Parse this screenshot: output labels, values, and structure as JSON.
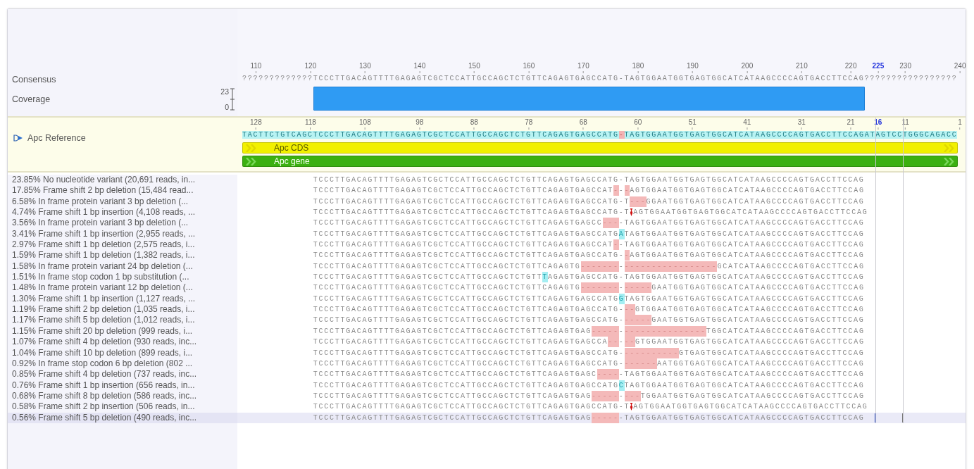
{
  "consensus": {
    "label": "Consensus",
    "ruler": [
      {
        "label": "110",
        "selected": false
      },
      {
        "label": "120",
        "selected": false
      },
      {
        "label": "130",
        "selected": false
      },
      {
        "label": "140",
        "selected": false
      },
      {
        "label": "150",
        "selected": false
      },
      {
        "label": "160",
        "selected": false
      },
      {
        "label": "170",
        "selected": false
      },
      {
        "label": "180",
        "selected": false
      },
      {
        "label": "190",
        "selected": false
      },
      {
        "label": "200",
        "selected": false
      },
      {
        "label": "210",
        "selected": false
      },
      {
        "label": "220",
        "selected": false
      },
      {
        "label": "225",
        "selected": true
      },
      {
        "label": "230",
        "selected": false
      },
      {
        "label": "240",
        "selected": false
      }
    ],
    "sequence": "?????????????TCCCTTGACAGTTTTGAGAGTCGCTCCATTGCCAGCTCTGTTCAGAGTGAGCCATG-TAGTGGAATGGTGAGTGGCATCATAAGCCCCAGTGACCTTCCAG?????????????????"
  },
  "coverage": {
    "label": "Coverage",
    "max": "23",
    "min": "0"
  },
  "reference": {
    "label": "Apc Reference",
    "ruler": [
      {
        "label": "128",
        "selected": false
      },
      {
        "label": "118",
        "selected": false
      },
      {
        "label": "108",
        "selected": false
      },
      {
        "label": "98",
        "selected": false
      },
      {
        "label": "88",
        "selected": false
      },
      {
        "label": "78",
        "selected": false
      },
      {
        "label": "68",
        "selected": false
      },
      {
        "label": "60",
        "selected": false
      },
      {
        "label": "51",
        "selected": false
      },
      {
        "label": "41",
        "selected": false
      },
      {
        "label": "31",
        "selected": false
      },
      {
        "label": "21",
        "selected": false
      },
      {
        "label": "16",
        "selected": true
      },
      {
        "label": "11",
        "selected": false
      },
      {
        "label": "1",
        "selected": false
      }
    ],
    "segments": [
      {
        "kind": "match",
        "text": "TACTTCTGTCAGCTCCCTTGACAGTTTTGAGAGTCGCTCCATTGCCAGCTCTGTTCAGAGTGAGCCATG"
      },
      {
        "kind": "deletion",
        "text": "-"
      },
      {
        "kind": "match",
        "text": "TAGTGGAATGGTGAGTGGCATCATAAGCCCCAGTGACCTTCCAGATAGTCCTGGGCAGACC"
      }
    ],
    "annotations": [
      {
        "label": "Apc CDS",
        "color": "#f2f000"
      },
      {
        "label": "Apc gene",
        "color": "#3cb010"
      }
    ]
  },
  "reads": [
    {
      "label": "23.85% No nucleotide variant (20,691 reads, in...",
      "selected": false,
      "segments": [
        {
          "kind": "match",
          "text": "TCCCTTGACAGTTTTGAGAGTCGCTCCATTGCCAGCTCTGTTCAGAGTGAGCCATG-TAGTGGAATGGTGAGTGGCATCATAAGCCCCAGTGACCTTCCAG"
        }
      ]
    },
    {
      "label": "17.85% Frame shift 2 bp deletion (15,484 read...",
      "selected": false,
      "segments": [
        {
          "kind": "match",
          "text": "TCCCTTGACAGTTTTGAGAGTCGCTCCATTGCCAGCTCTGTTCAGAGTGAGCCAT"
        },
        {
          "kind": "deletion",
          "text": "-"
        },
        {
          "kind": "match",
          "text": "-"
        },
        {
          "kind": "deletion",
          "text": "-"
        },
        {
          "kind": "match",
          "text": "AGTGGAATGGTGAGTGGCATCATAAGCCCCAGTGACCTTCCAG"
        }
      ]
    },
    {
      "label": "6.58% In frame protein variant 3 bp deletion (...",
      "selected": false,
      "segments": [
        {
          "kind": "match",
          "text": "TCCCTTGACAGTTTTGAGAGTCGCTCCATTGCCAGCTCTGTTCAGAGTGAGCCATG-T"
        },
        {
          "kind": "deletion",
          "text": "---"
        },
        {
          "kind": "match",
          "text": "GGAATGGTGAGTGGCATCATAAGCCCCAGTGACCTTCCAG"
        }
      ]
    },
    {
      "label": "4.74% Frame shift 1 bp insertion (4,108 reads, ...",
      "selected": false,
      "segments": [
        {
          "kind": "match",
          "text": "TCCCTTGACAGTTTTGAGAGTCGCTCCATTGCCAGCTCTGTTCAGAGTGAGCCATG-T"
        },
        {
          "kind": "insertion"
        },
        {
          "kind": "match",
          "text": "AGTGGAATGGTGAGTGGCATCATAAGCCCCAGTGACCTTCCAG"
        }
      ]
    },
    {
      "label": "3.56% In frame protein variant 3 bp deletion (...",
      "selected": false,
      "segments": [
        {
          "kind": "match",
          "text": "TCCCTTGACAGTTTTGAGAGTCGCTCCATTGCCAGCTCTGTTCAGAGTGAGCC"
        },
        {
          "kind": "deletion",
          "text": "---"
        },
        {
          "kind": "match",
          "text": "-TAGTGGAATGGTGAGTGGCATCATAAGCCCCAGTGACCTTCCAG"
        }
      ]
    },
    {
      "label": "3.41% Frame shift 1 bp insertion (2,955 reads, ...",
      "selected": false,
      "segments": [
        {
          "kind": "match",
          "text": "TCCCTTGACAGTTTTGAGAGTCGCTCCATTGCCAGCTCTGTTCAGAGTGAGCCATG"
        },
        {
          "kind": "base",
          "text": "A"
        },
        {
          "kind": "match",
          "text": "TAGTGGAATGGTGAGTGGCATCATAAGCCCCAGTGACCTTCCAG"
        }
      ]
    },
    {
      "label": "2.97% Frame shift 1 bp deletion (2,575 reads, i...",
      "selected": false,
      "segments": [
        {
          "kind": "match",
          "text": "TCCCTTGACAGTTTTGAGAGTCGCTCCATTGCCAGCTCTGTTCAGAGTGAGCCAT"
        },
        {
          "kind": "deletion",
          "text": "-"
        },
        {
          "kind": "match",
          "text": "-TAGTGGAATGGTGAGTGGCATCATAAGCCCCAGTGACCTTCCAG"
        }
      ]
    },
    {
      "label": "1.59% Frame shift 1 bp deletion (1,382 reads, i...",
      "selected": false,
      "segments": [
        {
          "kind": "match",
          "text": "TCCCTTGACAGTTTTGAGAGTCGCTCCATTGCCAGCTCTGTTCAGAGTGAGCCATG-"
        },
        {
          "kind": "deletion",
          "text": "-"
        },
        {
          "kind": "match",
          "text": "AGTGGAATGGTGAGTGGCATCATAAGCCCCAGTGACCTTCCAG"
        }
      ]
    },
    {
      "label": "1.58% In frame protein variant 24 bp deletion (...",
      "selected": false,
      "segments": [
        {
          "kind": "match",
          "text": "TCCCTTGACAGTTTTGAGAGTCGCTCCATTGCCAGCTCTGTTCAGAGTG"
        },
        {
          "kind": "deletion",
          "text": "-------"
        },
        {
          "kind": "match",
          "text": "-"
        },
        {
          "kind": "deletion",
          "text": "-----------------"
        },
        {
          "kind": "match",
          "text": "GCATCATAAGCCCCAGTGACCTTCCAG"
        }
      ]
    },
    {
      "label": "1.51% In frame stop codon 1 bp substitution (...",
      "selected": false,
      "segments": [
        {
          "kind": "match",
          "text": "TCCCTTGACAGTTTTGAGAGTCGCTCCATTGCCAGCTCTGTT"
        },
        {
          "kind": "base",
          "text": "T"
        },
        {
          "kind": "match",
          "text": "AGAGTGAGCCATG-TAGTGGAATGGTGAGTGGCATCATAAGCCCCAGTGACCTTCCAG"
        }
      ]
    },
    {
      "label": "1.48% In frame protein variant 12 bp deletion (...",
      "selected": false,
      "segments": [
        {
          "kind": "match",
          "text": "TCCCTTGACAGTTTTGAGAGTCGCTCCATTGCCAGCTCTGTTCAGAGTG"
        },
        {
          "kind": "deletion",
          "text": "-------"
        },
        {
          "kind": "match",
          "text": "-"
        },
        {
          "kind": "deletion",
          "text": "-----"
        },
        {
          "kind": "match",
          "text": "GAATGGTGAGTGGCATCATAAGCCCCAGTGACCTTCCAG"
        }
      ]
    },
    {
      "label": "1.30% Frame shift 1 bp insertion (1,127 reads, ...",
      "selected": false,
      "segments": [
        {
          "kind": "match",
          "text": "TCCCTTGACAGTTTTGAGAGTCGCTCCATTGCCAGCTCTGTTCAGAGTGAGCCATG"
        },
        {
          "kind": "base",
          "text": "G"
        },
        {
          "kind": "match",
          "text": "TAGTGGAATGGTGAGTGGCATCATAAGCCCCAGTGACCTTCCAG"
        }
      ]
    },
    {
      "label": "1.19% Frame shift 2 bp deletion (1,035 reads, i...",
      "selected": false,
      "segments": [
        {
          "kind": "match",
          "text": "TCCCTTGACAGTTTTGAGAGTCGCTCCATTGCCAGCTCTGTTCAGAGTGAGCCATG-"
        },
        {
          "kind": "deletion",
          "text": "--"
        },
        {
          "kind": "match",
          "text": "GTGGAATGGTGAGTGGCATCATAAGCCCCAGTGACCTTCCAG"
        }
      ]
    },
    {
      "label": "1.17% Frame shift 5 bp deletion (1,012 reads, i...",
      "selected": false,
      "segments": [
        {
          "kind": "match",
          "text": "TCCCTTGACAGTTTTGAGAGTCGCTCCATTGCCAGCTCTGTTCAGAGTGAGCCATG-"
        },
        {
          "kind": "deletion",
          "text": "-----"
        },
        {
          "kind": "match",
          "text": "GAATGGTGAGTGGCATCATAAGCCCCAGTGACCTTCCAG"
        }
      ]
    },
    {
      "label": "1.15% Frame shift 20 bp deletion (999 reads, i...",
      "selected": false,
      "segments": [
        {
          "kind": "match",
          "text": "TCCCTTGACAGTTTTGAGAGTCGCTCCATTGCCAGCTCTGTTCAGAGTGAG"
        },
        {
          "kind": "deletion",
          "text": "-----"
        },
        {
          "kind": "match",
          "text": "-"
        },
        {
          "kind": "deletion",
          "text": "---------------"
        },
        {
          "kind": "match",
          "text": "TGGCATCATAAGCCCCAGTGACCTTCCAG"
        }
      ]
    },
    {
      "label": "1.07% Frame shift 4 bp deletion (930 reads, inc...",
      "selected": false,
      "segments": [
        {
          "kind": "match",
          "text": "TCCCTTGACAGTTTTGAGAGTCGCTCCATTGCCAGCTCTGTTCAGAGTGAGCCA"
        },
        {
          "kind": "deletion",
          "text": "--"
        },
        {
          "kind": "match",
          "text": "-"
        },
        {
          "kind": "deletion",
          "text": "--"
        },
        {
          "kind": "match",
          "text": "GTGGAATGGTGAGTGGCATCATAAGCCCCAGTGACCTTCCAG"
        }
      ]
    },
    {
      "label": "1.04% Frame shift 10 bp deletion (899 reads, i...",
      "selected": false,
      "segments": [
        {
          "kind": "match",
          "text": "TCCCTTGACAGTTTTGAGAGTCGCTCCATTGCCAGCTCTGTTCAGAGTGAGCCATG-"
        },
        {
          "kind": "deletion",
          "text": "----------"
        },
        {
          "kind": "match",
          "text": "GTGAGTGGCATCATAAGCCCCAGTGACCTTCCAG"
        }
      ]
    },
    {
      "label": "0.92% In frame stop codon 6 bp deletion (802 ...",
      "selected": false,
      "segments": [
        {
          "kind": "match",
          "text": "TCCCTTGACAGTTTTGAGAGTCGCTCCATTGCCAGCTCTGTTCAGAGTGAGCCATG-"
        },
        {
          "kind": "deletion",
          "text": "------"
        },
        {
          "kind": "match",
          "text": "AATGGTGAGTGGCATCATAAGCCCCAGTGACCTTCCAG"
        }
      ]
    },
    {
      "label": "0.85% Frame shift 4 bp deletion (737 reads, inc...",
      "selected": false,
      "segments": [
        {
          "kind": "match",
          "text": "TCCCTTGACAGTTTTGAGAGTCGCTCCATTGCCAGCTCTGTTCAGAGTGAGC"
        },
        {
          "kind": "deletion",
          "text": "----"
        },
        {
          "kind": "match",
          "text": "-TAGTGGAATGGTGAGTGGCATCATAAGCCCCAGTGACCTTCCAG"
        }
      ]
    },
    {
      "label": "0.76% Frame shift 1 bp insertion (656 reads, in...",
      "selected": false,
      "segments": [
        {
          "kind": "match",
          "text": "TCCCTTGACAGTTTTGAGAGTCGCTCCATTGCCAGCTCTGTTCAGAGTGAGCCATG"
        },
        {
          "kind": "base",
          "text": "C"
        },
        {
          "kind": "match",
          "text": "TAGTGGAATGGTGAGTGGCATCATAAGCCCCAGTGACCTTCCAG"
        }
      ]
    },
    {
      "label": "0.68% Frame shift 8 bp deletion (586 reads, inc...",
      "selected": false,
      "segments": [
        {
          "kind": "match",
          "text": "TCCCTTGACAGTTTTGAGAGTCGCTCCATTGCCAGCTCTGTTCAGAGTGAG"
        },
        {
          "kind": "deletion",
          "text": "-----"
        },
        {
          "kind": "match",
          "text": "-"
        },
        {
          "kind": "deletion",
          "text": "---"
        },
        {
          "kind": "match",
          "text": "TGGAATGGTGAGTGGCATCATAAGCCCCAGTGACCTTCCAG"
        }
      ]
    },
    {
      "label": "0.58% Frame shift 2 bp insertion (506 reads, in...",
      "selected": false,
      "segments": [
        {
          "kind": "match",
          "text": "TCCCTTGACAGTTTTGAGAGTCGCTCCATTGCCAGCTCTGTTCAGAGTGAGCCATG-T"
        },
        {
          "kind": "insertion"
        },
        {
          "kind": "match",
          "text": "AGTGGAATGGTGAGTGGCATCATAAGCCCCAGTGACCTTCCAG"
        }
      ]
    },
    {
      "label": "0.56% Frame shift 5 bp deletion (490 reads, inc...",
      "selected": true,
      "segments": [
        {
          "kind": "match",
          "text": "TCCCTTGACAGTTTTGAGAGTCGCTCCATTGCCAGCTCTGTTCAGAGTGAG"
        },
        {
          "kind": "deletion",
          "text": "-----"
        },
        {
          "kind": "match",
          "text": "-TAGTGGAATGGTGAGTGGCATCATAAGCCCCAGTGACCTTCCAG"
        }
      ]
    }
  ]
}
